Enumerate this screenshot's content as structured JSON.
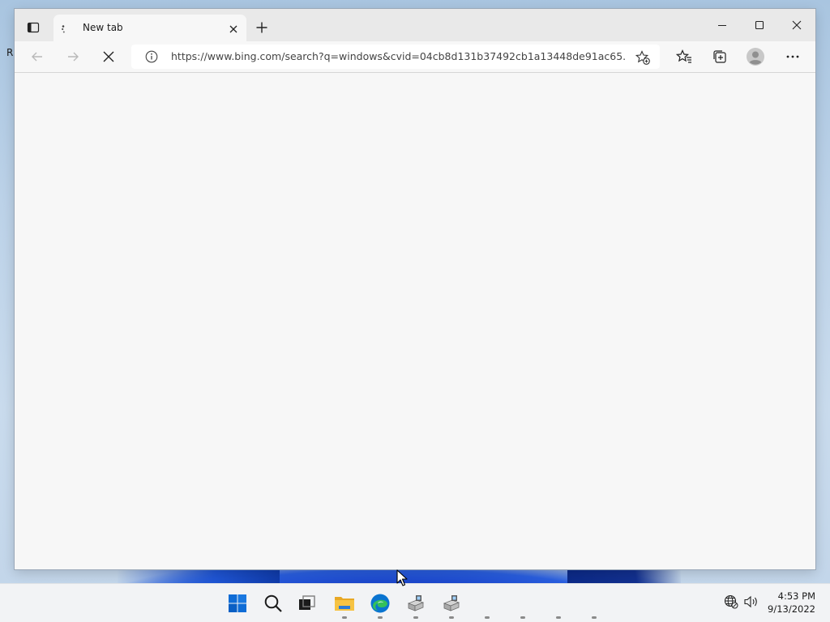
{
  "desktop": {
    "edge_letter": "R"
  },
  "browser": {
    "tab": {
      "title": "New tab",
      "favicon": "loading-spinner-icon"
    },
    "window_controls": [
      "minimize-icon",
      "maximize-icon",
      "close-icon"
    ],
    "toolbar": {
      "back_icon": "back-arrow-icon",
      "forward_icon": "forward-arrow-icon",
      "stop_icon": "stop-loading-icon",
      "address": {
        "url": "https://www.bing.com/search?q=windows&cvid=04cb8d131b37492cb1a13448de91ac65..."
      },
      "right_icons": [
        "add-favorite-icon",
        "favorites-icon",
        "collections-icon",
        "profile-icon",
        "more-menu-icon"
      ]
    },
    "page": {
      "state": "loading",
      "background": "#f7f7f7"
    }
  },
  "taskbar": {
    "icons": [
      "windows-start-icon",
      "search-icon",
      "task-view-icon",
      "file-explorer-icon",
      "edge-icon",
      "app-icon",
      "app-icon"
    ],
    "running": [
      "file-explorer-icon",
      "edge-icon",
      "app-icon",
      "app-icon"
    ],
    "tray": {
      "network_icon": "network-globe-icon",
      "volume_icon": "volume-icon"
    },
    "clock": {
      "time": "4:53 PM",
      "date": "9/13/2022"
    }
  },
  "colors": {
    "start_blue": "#0067c0",
    "edge_blue": "#0a74d0",
    "edge_green": "#34c05a",
    "folder_yellow": "#f6c343"
  }
}
